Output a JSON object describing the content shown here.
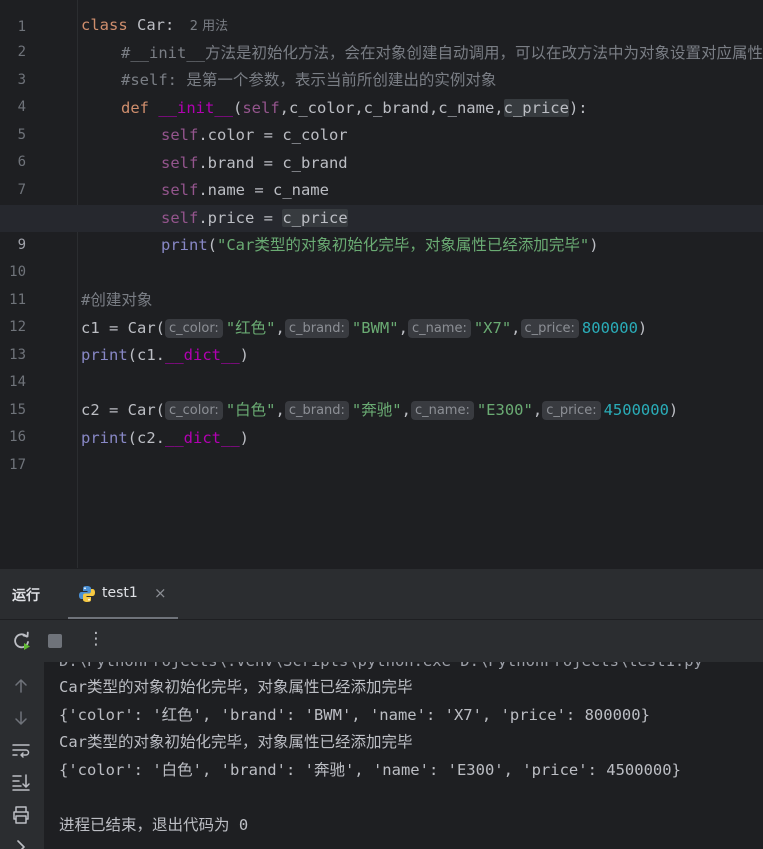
{
  "editor": {
    "lines": [
      {
        "n": "1"
      },
      {
        "n": "2",
        "kw": "class",
        "cls": "Car:",
        "usage": "2 用法"
      },
      {
        "n": "3",
        "comment": "#__init__方法是初始化方法，会在对象创建自动调用，可以在改方法中为对象设置对应属性"
      },
      {
        "n": "4",
        "comment": "#self: 是第一个参数，表示当前所创建出的实例对象"
      },
      {
        "n": "5",
        "kw": "def",
        "fn": "__init__",
        "open": "(",
        "self": "self",
        "params": ",c_color,c_brand,c_name,",
        "last": "c_price",
        "close": "):"
      },
      {
        "n": "6",
        "self": "self",
        "rest": ".color = c_color"
      },
      {
        "n": "7",
        "self": "self",
        "rest": ".brand = c_brand"
      },
      {
        "n": "8",
        "self": "self",
        "rest": ".name = c_name"
      },
      {
        "n": "9",
        "self": "self",
        "mid": ".price = ",
        "var": "c_price"
      },
      {
        "n": "10",
        "fn": "print",
        "open": "(",
        "str": "\"Car类型的对象初始化完毕，对象属性已经添加完毕\"",
        "close": ")"
      },
      {
        "n": "11"
      },
      {
        "n": "12",
        "comment": "#创建对象"
      },
      {
        "n": "13",
        "pre": "c1 = Car(",
        "h1": "c_color:",
        "a1": "\"红色\"",
        "h2": "c_brand:",
        "a2": "\"BWM\"",
        "h3": "c_name:",
        "a3": "\"X7\"",
        "h4": "c_price:",
        "a4": "800000",
        "close": ")"
      },
      {
        "n": "14",
        "fn": "print",
        "pre": "(c1.",
        "dunder": "__dict__",
        "close": ")"
      },
      {
        "n": "15"
      },
      {
        "n": "16",
        "pre": "c2 = Car(",
        "h1": "c_color:",
        "a1": "\"白色\"",
        "h2": "c_brand:",
        "a2": "\"奔驰\"",
        "h3": "c_name:",
        "a3": "\"E300\"",
        "h4": "c_price:",
        "a4": "4500000",
        "close": ")"
      },
      {
        "n": "17",
        "fn": "print",
        "pre": "(c2.",
        "dunder": "__dict__",
        "close": ")"
      }
    ],
    "comma": ","
  },
  "run_panel": {
    "title": "运行",
    "tab_label": "test1",
    "tab_close": "×",
    "more_icon": "⋮",
    "console": [
      "D:\\PythonProjects\\.venv\\Scripts\\python.exe D:\\PythonProjects\\test1.py",
      "Car类型的对象初始化完毕，对象属性已经添加完毕",
      "{'color': '红色', 'brand': 'BWM', 'name': 'X7', 'price': 800000}",
      "Car类型的对象初始化完毕，对象属性已经添加完毕",
      "{'color': '白色', 'brand': '奔驰', 'name': 'E300', 'price': 4500000}",
      "",
      "进程已结束，退出代码为 0"
    ]
  },
  "colors": {
    "background": "#1e1f22",
    "panel": "#2b2d30",
    "keyword": "#cf8e6d",
    "string": "#6aab73",
    "number": "#2aacb8",
    "self": "#94558d",
    "dunder": "#b200b2",
    "function": "#56a8f5",
    "comment": "#7a7e85"
  },
  "icons": [
    "rerun-icon",
    "stop-icon",
    "more-icon",
    "python-file-icon",
    "close-icon",
    "scroll-up-icon",
    "scroll-down-icon",
    "soft-wrap-icon",
    "scroll-to-end-icon",
    "print-icon"
  ]
}
